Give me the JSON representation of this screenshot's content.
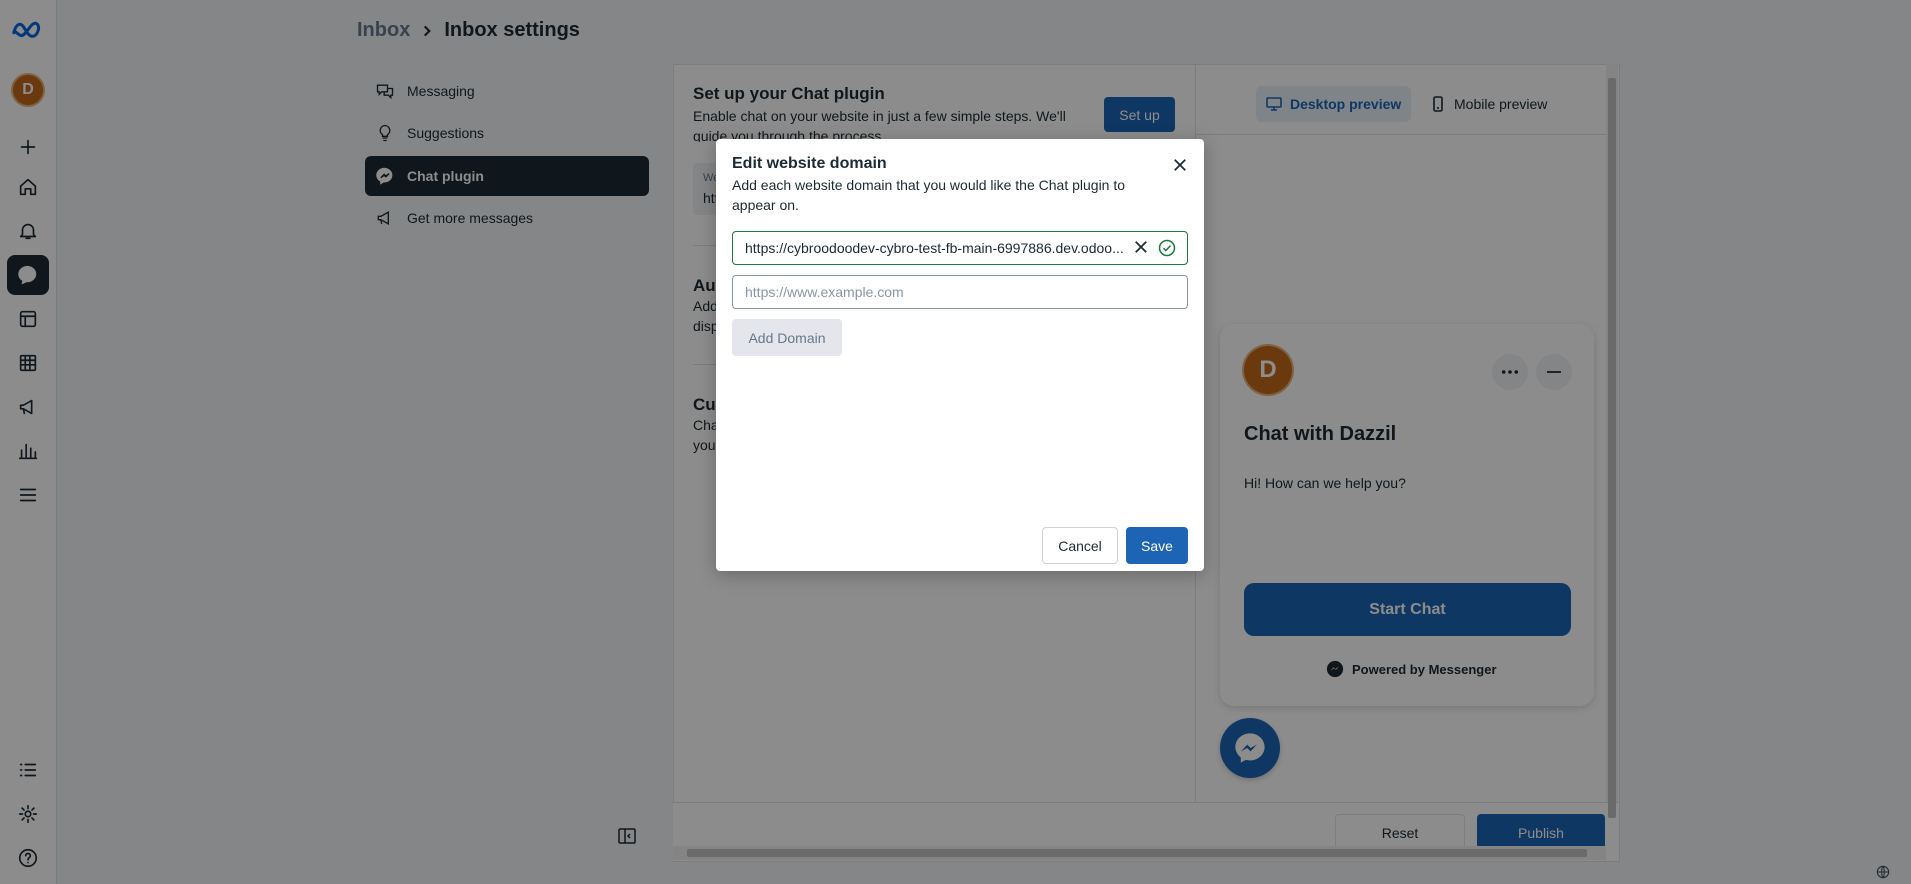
{
  "breadcrumb": {
    "parent": "Inbox",
    "current": "Inbox settings"
  },
  "rail": {
    "avatar_letter": "D",
    "icons": [
      "meta-logo-icon",
      "create-icon",
      "home-icon",
      "notifications-icon",
      "inbox-icon",
      "content-icon",
      "planner-icon",
      "ads-icon",
      "insights-icon",
      "menu-icon",
      "all-tools-icon",
      "settings-icon",
      "help-icon"
    ]
  },
  "settings_nav": {
    "items": [
      {
        "label": "Messaging",
        "icon": "chat-bubbles-icon"
      },
      {
        "label": "Suggestions",
        "icon": "lightbulb-icon"
      },
      {
        "label": "Chat plugin",
        "icon": "messenger-icon",
        "selected": true
      },
      {
        "label": "Get more messages",
        "icon": "megaphone-icon"
      }
    ]
  },
  "setup": {
    "title": "Set up your Chat plugin",
    "description": "Enable chat on your website in just a few simple steps. We'll guide you through the process.",
    "button": "Set up",
    "website_label": "We",
    "website_value": "htt"
  },
  "sections_partial": [
    {
      "title": "Au",
      "line1": "Add",
      "line2": "disp"
    },
    {
      "title": "Cu",
      "line1": "Cha",
      "line2": "you"
    }
  ],
  "preview_tabs": {
    "desktop": "Desktop preview",
    "mobile": "Mobile preview",
    "active": "desktop"
  },
  "chat_preview": {
    "avatar_letter": "D",
    "title": "Chat with Dazzil",
    "greeting": "Hi! How can we help you?",
    "start_button": "Start Chat",
    "powered_by": "Powered by Messenger"
  },
  "footer": {
    "reset": "Reset",
    "publish": "Publish"
  },
  "modal": {
    "title": "Edit website domain",
    "description": "Add each website domain that you would like the Chat plugin to appear on.",
    "domains": [
      "https://cybroodoodev-cybro-test-fb-main-6997886.dev.odoo...."
    ],
    "new_domain_placeholder": "https://www.example.com",
    "add_button": "Add Domain",
    "cancel": "Cancel",
    "save": "Save"
  },
  "colors": {
    "accent": "#1d65b4",
    "dark": "#1c2b33",
    "valid": "#1c7a3a",
    "avatar": "#c26a1a"
  }
}
